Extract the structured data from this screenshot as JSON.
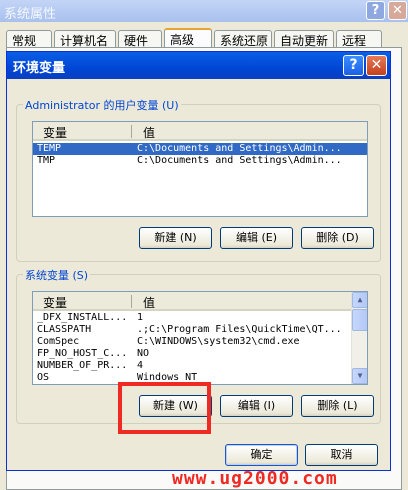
{
  "system_properties": {
    "title": "系统属性",
    "tabs": [
      "常规",
      "计算机名",
      "硬件",
      "高级",
      "系统还原",
      "自动更新",
      "远程"
    ],
    "active_tab": "高级"
  },
  "dialog": {
    "title": "环境变量",
    "help_glyph": "?",
    "close_glyph": "✕",
    "user_vars": {
      "label": "Administrator 的用户变量 (U)",
      "columns": [
        "变量",
        "值"
      ],
      "rows": [
        {
          "name": "TEMP",
          "value": "C:\\Documents and Settings\\Admin...",
          "selected": true
        },
        {
          "name": "TMP",
          "value": "C:\\Documents and Settings\\Admin...",
          "selected": false
        }
      ],
      "buttons": {
        "new": "新建 (N)",
        "edit": "编辑 (E)",
        "delete": "删除 (D)"
      }
    },
    "system_vars": {
      "label": "系统变量 (S)",
      "columns": [
        "变量",
        "值"
      ],
      "rows": [
        {
          "name": "_DFX_INSTALL...",
          "value": "1"
        },
        {
          "name": "CLASSPATH",
          "value": ".;C:\\Program Files\\QuickTime\\QT..."
        },
        {
          "name": "ComSpec",
          "value": "C:\\WINDOWS\\system32\\cmd.exe"
        },
        {
          "name": "FP_NO_HOST_C...",
          "value": "NO"
        },
        {
          "name": "NUMBER_OF_PR...",
          "value": "4"
        },
        {
          "name": "OS",
          "value": "Windows_NT"
        }
      ],
      "buttons": {
        "new": "新建 (W)",
        "edit": "编辑 (I)",
        "delete": "删除 (L)"
      }
    },
    "ok": "确定",
    "cancel": "取消"
  },
  "watermark": "www.ug2000.com",
  "colors": {
    "highlight": "#ee2a23",
    "title_blue": "#0046d5",
    "selection": "#316ac5"
  }
}
